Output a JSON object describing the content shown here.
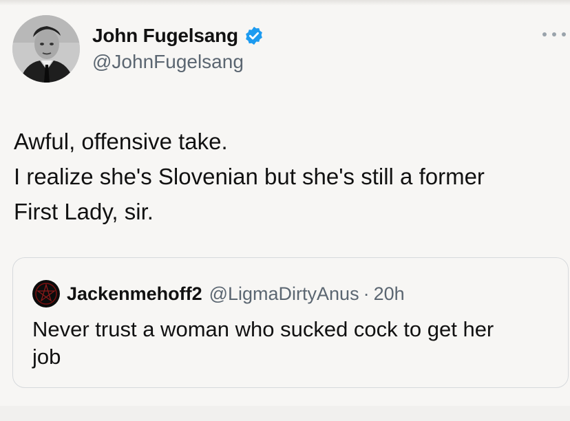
{
  "author": {
    "display_name": "John Fugelsang",
    "handle": "@JohnFugelsang",
    "verified_icon": "verified-badge-icon",
    "accent_color": "#1d9bf0"
  },
  "tweet": {
    "lines": [
      "Awful, offensive take.",
      "I realize she's Slovenian but she's still a former",
      "First Lady, sir."
    ]
  },
  "quoted_tweet": {
    "display_name": "Jackenmehoff2",
    "handle": "@LigmaDirtyAnus",
    "separator": "·",
    "time": "20h",
    "lines": [
      "Never trust a woman who sucked cock to get her",
      "job"
    ]
  }
}
